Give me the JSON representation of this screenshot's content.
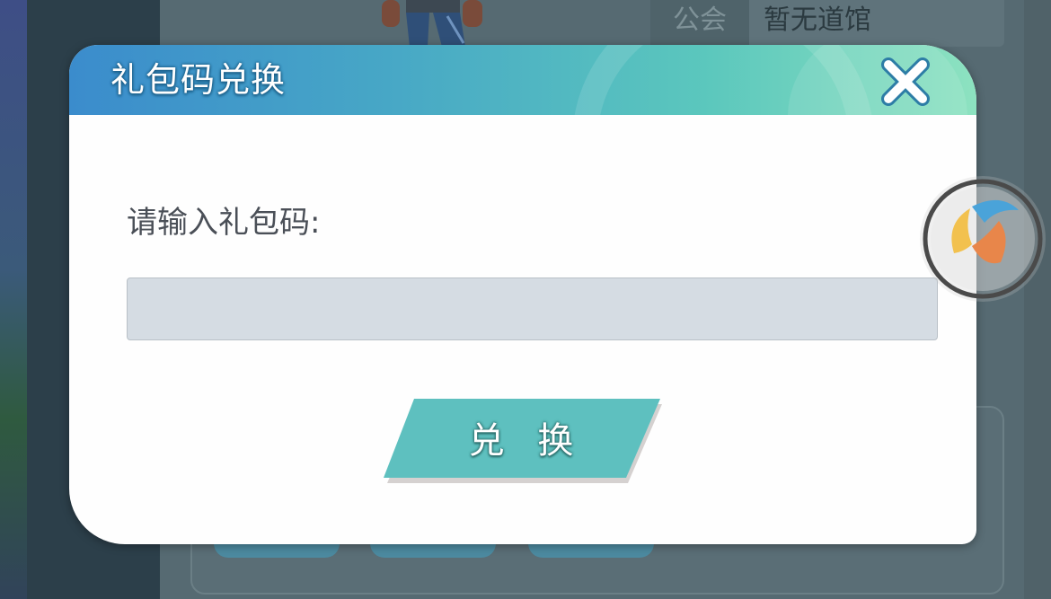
{
  "background": {
    "info_label": "公会",
    "info_value": "暂无道馆"
  },
  "dialog": {
    "title": "礼包码兑换",
    "prompt": "请输入礼包码:",
    "input_value": "",
    "input_placeholder": "",
    "redeem_label": "兑 换",
    "close_icon": "close-icon"
  },
  "floating_ball": {
    "icon": "assistant-logo-icon"
  },
  "colors": {
    "header_start": "#3b8ccc",
    "header_end": "#8de2c0",
    "redeem_button": "#5ec0bf",
    "input_bg": "#d5dce3"
  }
}
